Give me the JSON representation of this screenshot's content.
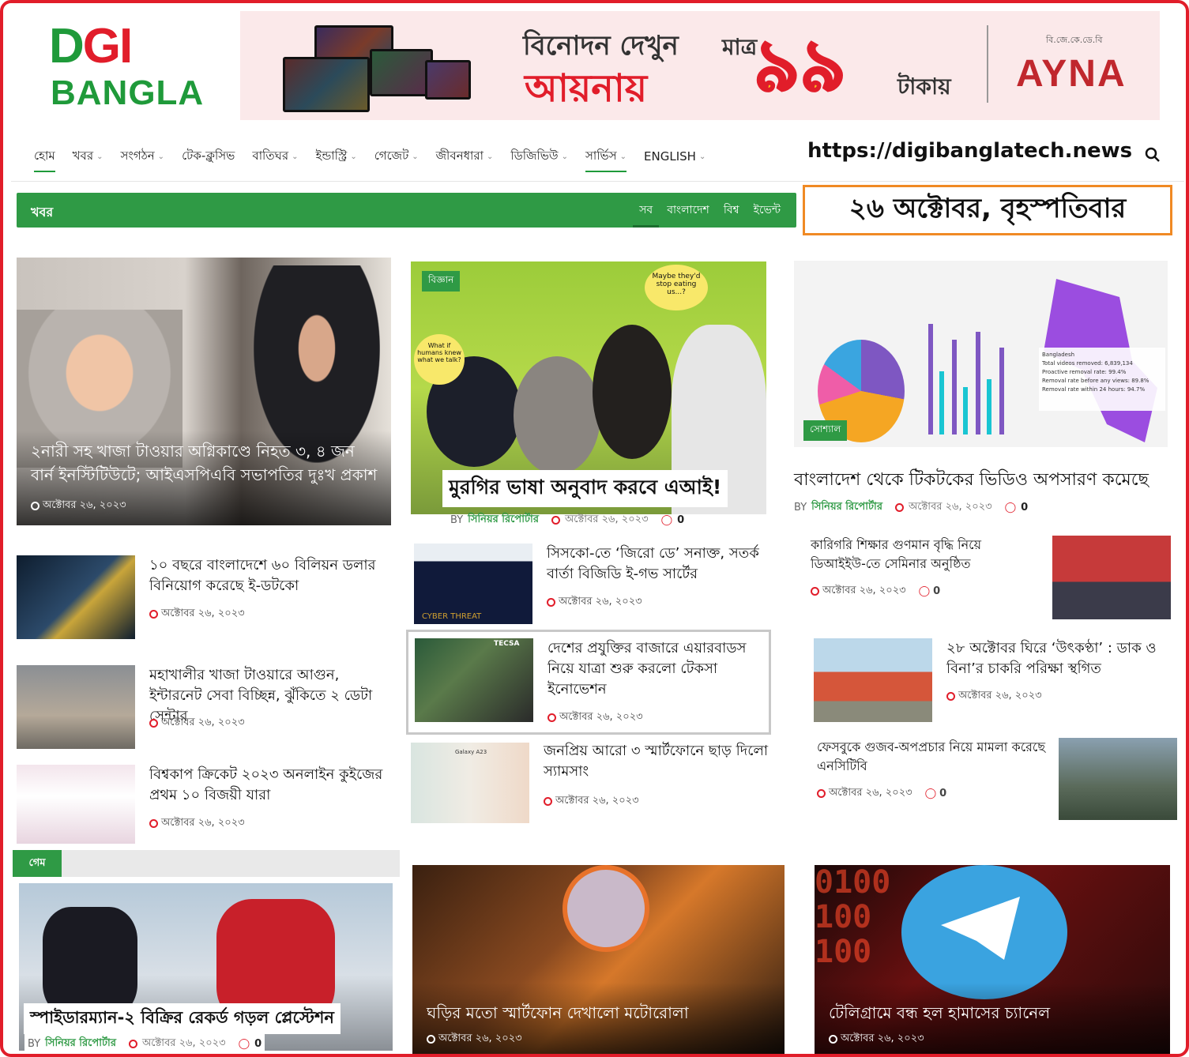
{
  "logo": {
    "top_part1": "D",
    "top_part2": "GI",
    "bottom": "BANGLA"
  },
  "banner": {
    "line1": "বিনোদন দেখুন",
    "line2": "আয়নায়",
    "only": "মাত্র",
    "price": "৯৯",
    "taka": "টাকায়",
    "small": "বি.জে.কে.ডে.বি",
    "brand": "AYNA"
  },
  "nav": {
    "items": [
      {
        "label": "হোম",
        "active": true,
        "dropdown": false
      },
      {
        "label": "খবর",
        "dropdown": true
      },
      {
        "label": "সংগঠন",
        "dropdown": true
      },
      {
        "label": "টেক-ক্লুসিভ",
        "dropdown": false
      },
      {
        "label": "বাতিঘর",
        "dropdown": true
      },
      {
        "label": "ইন্ডাস্ট্রি",
        "dropdown": true
      },
      {
        "label": "গেজেট",
        "dropdown": true
      },
      {
        "label": "জীবনধারা",
        "dropdown": true
      },
      {
        "label": "ডিজিভিউ",
        "dropdown": true
      },
      {
        "label": "সার্ভিস",
        "active": true,
        "dropdown": true
      },
      {
        "label": "ENGLISH",
        "dropdown": true
      }
    ],
    "url": "https://digibanglatech.news"
  },
  "section": {
    "title": "খবর",
    "tabs": [
      "সব",
      "বাংলাদেশ",
      "বিশ্ব",
      "ইভেন্ট"
    ]
  },
  "date_box": "২৬ অক্টোবর, বৃহস্পতিবার",
  "date_text": "অক্টোবর ২৬, ২০২৩",
  "by": "BY",
  "author": "সিনিয়র রিপোর্টার",
  "comments": "0",
  "featured_left": {
    "title": "২নারী সহ খাজা টাওয়ার অগ্নিকাণ্ডে নিহত ৩, ৪ জন বার্ন ইনস্টিটিউটে; আইএসপিএবি সভাপতির দুঃখ প্রকাশ"
  },
  "featured_mid": {
    "tag": "বিজ্ঞান",
    "title": "মুরগির ভাষা অনুবাদ করবে এআই!",
    "bubble1": "Maybe they'd stop eating us...?",
    "bubble2": "What if humans knew what we talk?"
  },
  "featured_right": {
    "tag": "সোশ্যাল",
    "title": "বাংলাদেশ থেকে টিকটকের ভিডিও অপসারণ কমেছে",
    "map_label": "Bangladesh",
    "map_line1": "Total videos removed: 6,839,134",
    "map_line2": "Proactive removal rate: 99.4%",
    "map_line3": "Removal rate before any views: 89.8%",
    "map_line4": "Removal rate within 24 hours: 94.7%"
  },
  "left_list": [
    {
      "title": "১০ বছরে বাংলাদেশে ৬০ বিলিয়ন ডলার বিনিয়োগ করেছে ই-ডটকো"
    },
    {
      "title": "মহাখালীর খাজা টাওয়ারে আগুন, ইন্টারনেট সেবা বিচ্ছিন্ন, ঝুঁকিতে ২ ডেটা সেন্টার"
    },
    {
      "title": "বিশ্বকাপ ক্রিকেট ২০২৩ অনলাইন কুইজের প্রথম ১০ বিজয়ী যারা"
    }
  ],
  "mid_list": [
    {
      "title": "সিসকো-তে ‘জিরো ডে’ সনাক্ত, সতর্ক বার্তা বিজিডি ই-গভ সার্টের",
      "img_text": "CYBER THREAT"
    },
    {
      "title": "দেশের প্রযুক্তির বাজারে এয়ারবাডস নিয়ে যাত্রা শুরু করলো টেকসা ইনোভেশন",
      "img_text": "TECSA"
    },
    {
      "title": "জনপ্রিয় আরো ৩ স্মার্টফোনে ছাড় দিলো স্যামসাং",
      "img_text": "Galaxy A23"
    }
  ],
  "right_list": [
    {
      "title": "কারিগরি শিক্ষার গুণমান বৃদ্ধি নিয়ে ডিআইইউ-তে সেমিনার অনুষ্ঠিত"
    },
    {
      "title": "২৮ অক্টোবর ঘিরে ‘উৎকণ্ঠা’ : ডাক ও বিনা’র চাকরি পরিক্ষা স্থগিত"
    },
    {
      "title": "ফেসবুকে গুজব-অপপ্রচার নিয়ে মামলা করেছে এনসিটিবি"
    }
  ],
  "game_section": {
    "title": "গেম"
  },
  "bottom": [
    {
      "title": "স্পাইডারম্যান-২ বিক্রির রেকর্ড গড়ল প্লেস্টেশন"
    },
    {
      "title": "ঘড়ির মতো স্মার্টফোন দেখালো মটোরোলা"
    },
    {
      "title": "টেলিগ্রামে বন্ধ হল হামাসের চ্যানেল"
    }
  ]
}
